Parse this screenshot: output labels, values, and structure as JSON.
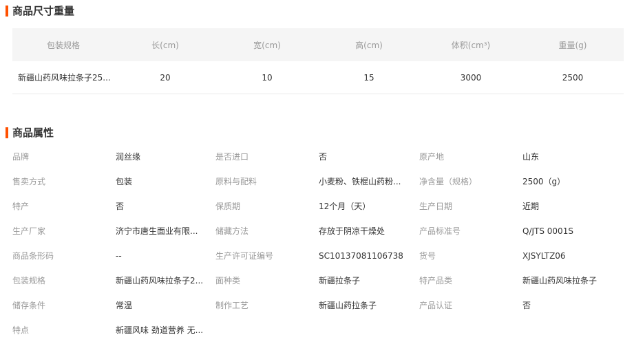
{
  "size_section": {
    "title": "商品尺寸重量",
    "headers": [
      "包装规格",
      "长(cm)",
      "宽(cm)",
      "高(cm)",
      "体积(cm³)",
      "重量(g)"
    ],
    "rows": [
      [
        "新疆山药风味拉条子25...",
        "20",
        "10",
        "15",
        "3000",
        "2500"
      ]
    ]
  },
  "attr_section": {
    "title": "商品属性",
    "rows": [
      [
        [
          "品牌",
          "润丝缘"
        ],
        [
          "是否进口",
          "否"
        ],
        [
          "原产地",
          "山东"
        ]
      ],
      [
        [
          "售卖方式",
          "包装"
        ],
        [
          "原料与配料",
          "小麦粉、铁棍山药粉..."
        ],
        [
          "净含量（规格）",
          "2500（g）"
        ]
      ],
      [
        [
          "特产",
          "否"
        ],
        [
          "保质期",
          "12个月（天）"
        ],
        [
          "生产日期",
          "近期"
        ]
      ],
      [
        [
          "生产厂家",
          "济宁市唐生面业有限..."
        ],
        [
          "储藏方法",
          "存放于阴凉干燥处"
        ],
        [
          "产品标准号",
          "Q/JTS 0001S"
        ]
      ],
      [
        [
          "商品条形码",
          "--"
        ],
        [
          "生产许可证编号",
          "SC10137081106738"
        ],
        [
          "货号",
          "XJSYLTZ06"
        ]
      ],
      [
        [
          "包装规格",
          "新疆山药风味拉条子2..."
        ],
        [
          "面种类",
          "新疆拉条子"
        ],
        [
          "特产品类",
          "新疆山药风味拉条子"
        ]
      ],
      [
        [
          "储存条件",
          "常温"
        ],
        [
          "制作工艺",
          "新疆山药拉条子"
        ],
        [
          "产品认证",
          "否"
        ]
      ],
      [
        [
          "特点",
          "新疆风味 劲道营养 无..."
        ]
      ]
    ]
  },
  "colors": {
    "accent": "#ff5000",
    "header_bg": "#f5f5f5",
    "label": "#999999",
    "value": "#333333"
  }
}
